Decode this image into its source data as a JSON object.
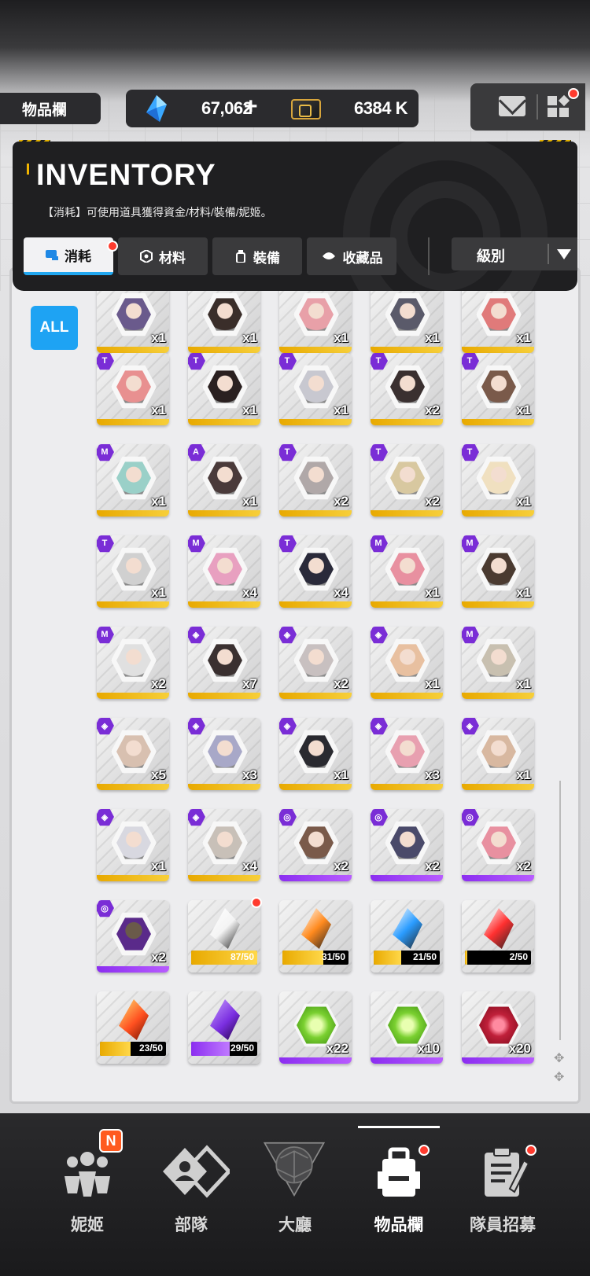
{
  "top_bar": {
    "section_tag": "物品欄",
    "gem_value": "67,062",
    "plus_label": "+",
    "credit_value": "6384 K"
  },
  "inventory": {
    "title": "INVENTORY",
    "description": "【消耗】可使用道具獲得資金/材料/裝備/妮姬。",
    "tabs": [
      {
        "label": "消耗",
        "active": true,
        "badge": true
      },
      {
        "label": "材料",
        "active": false
      },
      {
        "label": "裝備",
        "active": false
      },
      {
        "label": "收藏品",
        "active": false
      }
    ],
    "sort": {
      "label": "級別"
    },
    "filter_all": "ALL"
  },
  "items": [
    [
      {
        "qty": "x1",
        "corner": ""
      },
      {
        "qty": "x1",
        "corner": ""
      },
      {
        "qty": "x1",
        "corner": ""
      },
      {
        "qty": "x1",
        "corner": ""
      },
      {
        "qty": "x1",
        "corner": ""
      }
    ],
    [
      {
        "qty": "x1",
        "corner": "T"
      },
      {
        "qty": "x1",
        "corner": "T"
      },
      {
        "qty": "x1",
        "corner": "T"
      },
      {
        "qty": "x2",
        "corner": "T"
      },
      {
        "qty": "x1",
        "corner": "T"
      }
    ],
    [
      {
        "qty": "x1",
        "corner": "M"
      },
      {
        "qty": "x1",
        "corner": "A"
      },
      {
        "qty": "x2",
        "corner": "T"
      },
      {
        "qty": "x2",
        "corner": "T"
      },
      {
        "qty": "x1",
        "corner": "T"
      }
    ],
    [
      {
        "qty": "x1",
        "corner": "T"
      },
      {
        "qty": "x4",
        "corner": "M"
      },
      {
        "qty": "x4",
        "corner": "T"
      },
      {
        "qty": "x1",
        "corner": "M"
      },
      {
        "qty": "x1",
        "corner": "M"
      }
    ],
    [
      {
        "qty": "x2",
        "corner": "M"
      },
      {
        "qty": "x7",
        "corner": "◈"
      },
      {
        "qty": "x2",
        "corner": "◈"
      },
      {
        "qty": "x1",
        "corner": "◈"
      },
      {
        "qty": "x1",
        "corner": "M"
      }
    ],
    [
      {
        "qty": "x5",
        "corner": "◈"
      },
      {
        "qty": "x3",
        "corner": "◈"
      },
      {
        "qty": "x1",
        "corner": "◈"
      },
      {
        "qty": "x3",
        "corner": "◈"
      },
      {
        "qty": "x1",
        "corner": "◈"
      }
    ],
    [
      {
        "qty": "x1",
        "corner": "◈"
      },
      {
        "qty": "x4",
        "corner": "◈"
      },
      {
        "qty": "x2",
        "corner": "◎"
      },
      {
        "qty": "x2",
        "corner": "◎"
      },
      {
        "qty": "x2",
        "corner": "◎"
      }
    ]
  ],
  "row8": [
    {
      "qty": "x2",
      "corner": "◎"
    },
    {
      "progress": "87/50",
      "fraction": 1.0,
      "badge": true
    },
    {
      "progress": "31/50",
      "fraction": 0.62
    },
    {
      "progress": "21/50",
      "fraction": 0.42
    },
    {
      "progress": "2/50",
      "fraction": 0.04
    }
  ],
  "row9": [
    {
      "progress": "23/50",
      "fraction": 0.46
    },
    {
      "progress": "29/50",
      "fraction": 0.58
    },
    {
      "qty": "x22"
    },
    {
      "qty": "x10"
    },
    {
      "qty": "x20"
    }
  ],
  "nav": [
    {
      "label": "妮姬",
      "badge": "N"
    },
    {
      "label": "部隊"
    },
    {
      "label": "大廳"
    },
    {
      "label": "物品欄",
      "active": true
    },
    {
      "label": "隊員招募"
    }
  ],
  "colors": {
    "accent": "#1ea3f3",
    "rarity_yellow": "#e8a900",
    "rarity_purple": "#8b2ef0",
    "badge_red": "#ff3b2e"
  }
}
